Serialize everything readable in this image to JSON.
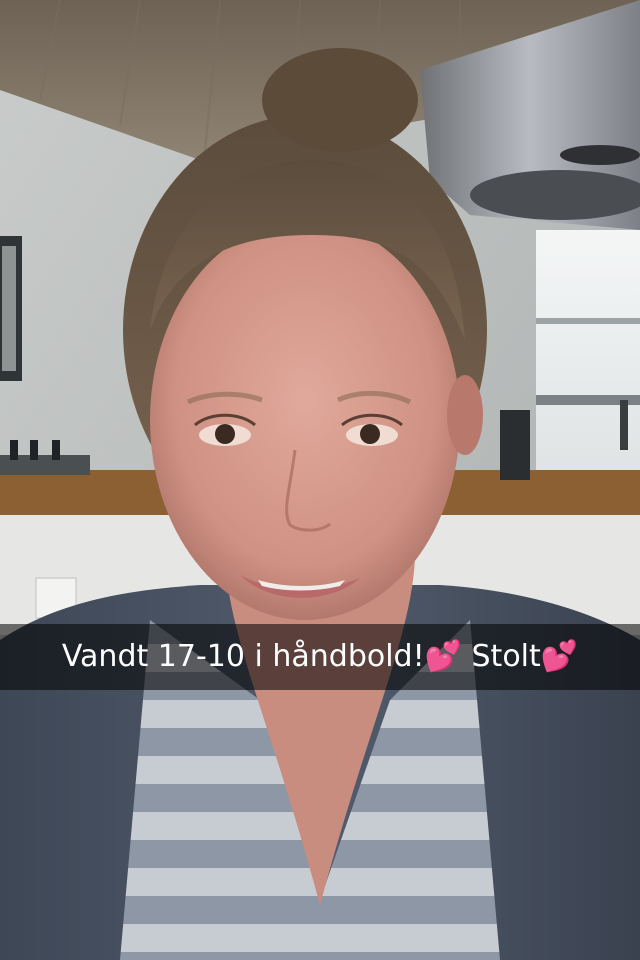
{
  "caption": {
    "text": "Vandt 17-10 i håndbold!💕 Stolt💕"
  }
}
